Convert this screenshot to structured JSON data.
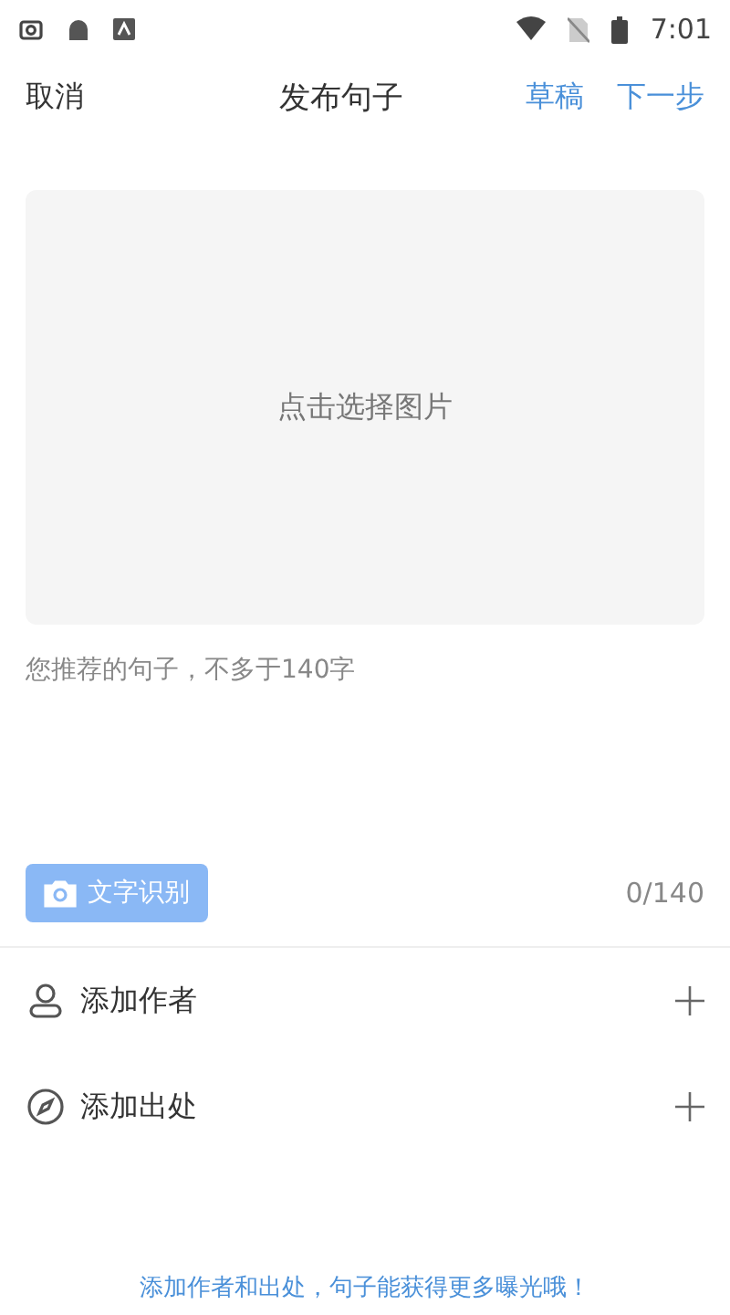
{
  "status_bar": {
    "time": "7:01"
  },
  "header": {
    "cancel": "取消",
    "title": "发布句子",
    "draft": "草稿",
    "next": "下一步"
  },
  "image_picker": {
    "label": "点击选择图片"
  },
  "text_input": {
    "placeholder": "您推荐的句子，不多于140字"
  },
  "ocr_button": {
    "label": "文字识别"
  },
  "counter": "0/140",
  "rows": [
    {
      "kind": "author",
      "label": "添加作者"
    },
    {
      "kind": "source",
      "label": "添加出处"
    }
  ],
  "footer_hint": "添加作者和出处，句子能获得更多曝光哦！"
}
